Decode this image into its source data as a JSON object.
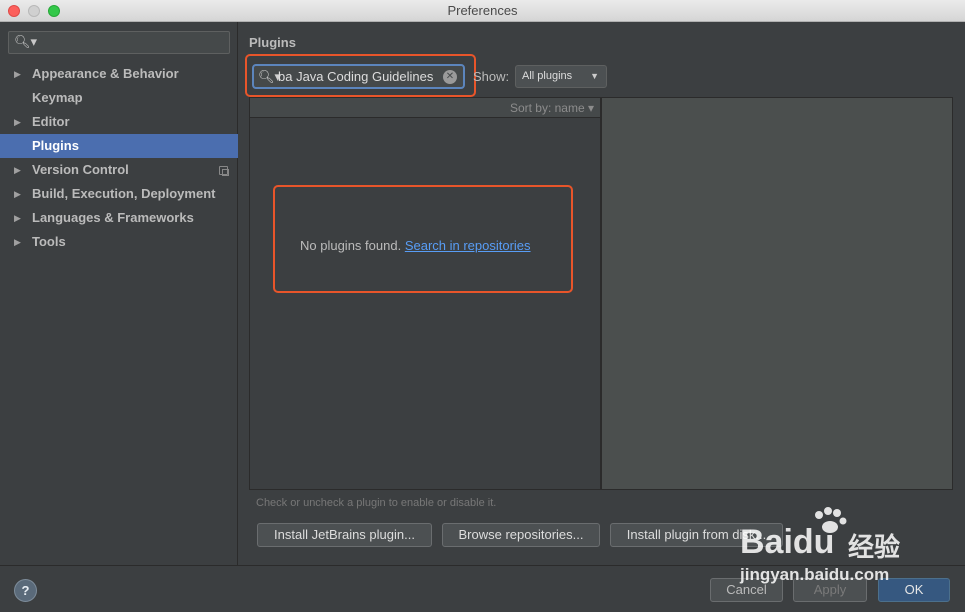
{
  "window": {
    "title": "Preferences"
  },
  "sidebar": {
    "search": {
      "value": "",
      "placeholder": ""
    },
    "items": [
      {
        "label": "Appearance & Behavior",
        "expandable": true,
        "selected": false
      },
      {
        "label": "Keymap",
        "expandable": false,
        "selected": false
      },
      {
        "label": "Editor",
        "expandable": true,
        "selected": false
      },
      {
        "label": "Plugins",
        "expandable": false,
        "selected": true
      },
      {
        "label": "Version Control",
        "expandable": true,
        "selected": false
      },
      {
        "label": "Build, Execution, Deployment",
        "expandable": true,
        "selected": false
      },
      {
        "label": "Languages & Frameworks",
        "expandable": true,
        "selected": false
      },
      {
        "label": "Tools",
        "expandable": true,
        "selected": false
      }
    ]
  },
  "main": {
    "title": "Plugins",
    "search": {
      "value": "ba Java Coding Guidelines"
    },
    "show": {
      "label": "Show:",
      "selected": "All plugins"
    },
    "list": {
      "sort_label": "Sort by: name",
      "empty_text": "No plugins found.",
      "empty_link": "Search in repositories"
    },
    "hint": "Check or uncheck a plugin to enable or disable it.",
    "buttons": {
      "install_jetbrains": "Install JetBrains plugin...",
      "browse": "Browse repositories...",
      "install_disk": "Install plugin from disk..."
    }
  },
  "footer": {
    "help": "?",
    "cancel": "Cancel",
    "apply": "Apply",
    "ok": "OK"
  },
  "watermark": {
    "brand": "Baidu",
    "cn": "经验",
    "url": "jingyan.baidu.com"
  },
  "colors": {
    "selection": "#4b6eaf",
    "link": "#589df6",
    "highlight": "#e8552a",
    "ok_button": "#365880"
  }
}
